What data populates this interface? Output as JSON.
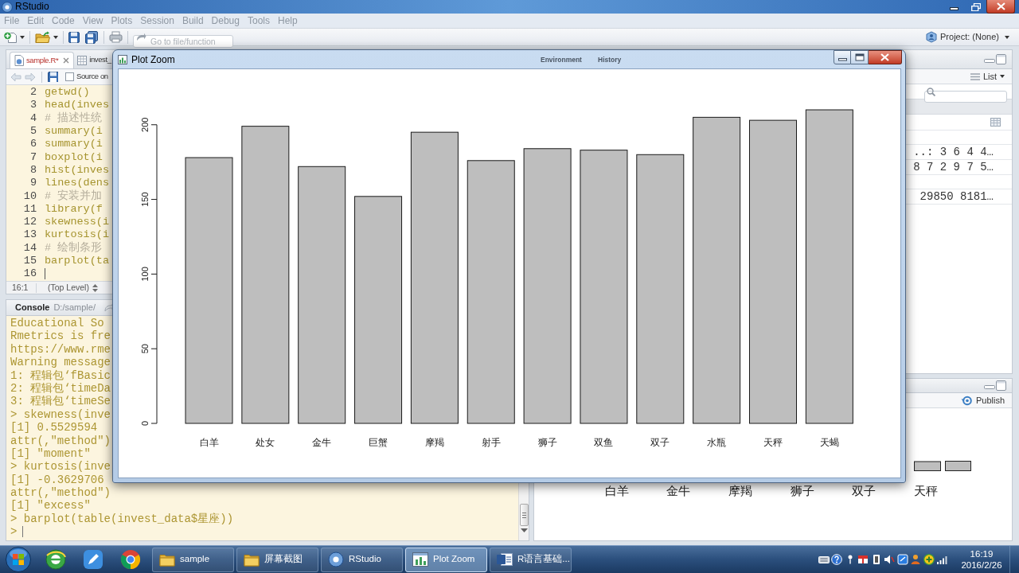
{
  "window": {
    "title": "RStudio"
  },
  "menu": [
    "File",
    "Edit",
    "Code",
    "View",
    "Plots",
    "Session",
    "Build",
    "Debug",
    "Tools",
    "Help"
  ],
  "toolbar": {
    "go_to_field": {
      "placeholder": "Go to file/function"
    },
    "project": "Project: (None)"
  },
  "editor": {
    "tabs": [
      {
        "label": "sample.R*",
        "selected": true,
        "modified": true,
        "kind": "script"
      },
      {
        "label": "invest_",
        "selected": false,
        "modified": false,
        "kind": "data"
      }
    ],
    "source_on_save": {
      "label": "Source on",
      "checked": false
    },
    "lines": [
      {
        "number": "2",
        "code": "getwd()",
        "kind": "code",
        "cursor": false
      },
      {
        "number": "3",
        "code": "head(inves",
        "kind": "code",
        "cursor": false
      },
      {
        "number": "4",
        "code": "# 描述性统",
        "kind": "comment",
        "cursor": false
      },
      {
        "number": "5",
        "code": "summary(i",
        "kind": "code",
        "cursor": false
      },
      {
        "number": "6",
        "code": "summary(i",
        "kind": "code",
        "cursor": false
      },
      {
        "number": "7",
        "code": "boxplot(i",
        "kind": "code",
        "cursor": false
      },
      {
        "number": "8",
        "code": "hist(inves",
        "kind": "code",
        "cursor": false
      },
      {
        "number": "9",
        "code": "lines(dens",
        "kind": "code",
        "cursor": false
      },
      {
        "number": "10",
        "code": "# 安装并加",
        "kind": "comment",
        "cursor": false
      },
      {
        "number": "11",
        "code": "library(f",
        "kind": "code",
        "cursor": false
      },
      {
        "number": "12",
        "code": "skewness(i",
        "kind": "code",
        "cursor": false
      },
      {
        "number": "13",
        "code": "kurtosis(i",
        "kind": "code",
        "cursor": false
      },
      {
        "number": "14",
        "code": "# 绘制条形",
        "kind": "comment",
        "cursor": false
      },
      {
        "number": "15",
        "code": "barplot(ta",
        "kind": "code",
        "cursor": false
      },
      {
        "number": "16",
        "kind": "code",
        "cursor": true
      }
    ],
    "status": {
      "position": "16:1",
      "scope": "(Top Level)"
    }
  },
  "console": {
    "title": "Console",
    "path": "D:/sample/",
    "lines": [
      "Educational So",
      "Rmetrics is fre",
      "https://www.rme",
      "Warning message",
      "1: 程辑包‘fBasic",
      "2: 程辑包‘timeDa",
      "3: 程辑包‘timeSe",
      "> skewness(inve",
      "[1] 0.5529594",
      "attr(,\"method\")",
      "[1] \"moment\"",
      "> kurtosis(inve",
      "[1] -0.3629706",
      "attr(,\"method\")",
      "[1] \"excess\"",
      "> barplot(table(invest_data$星座))"
    ],
    "prompt": ">",
    "cursor": true
  },
  "environment_pane": {
    "tabs": [
      {
        "label": "Environment"
      },
      {
        "label": "History"
      }
    ],
    "view_mode": "List",
    "rows": [
      {
        "kind": "section"
      },
      {
        "kind": "data-frame"
      },
      {
        "kind": "blank"
      },
      {
        "kind": "value",
        "text": "..: 3 6 4 4…"
      },
      {
        "kind": "value",
        "text": "8 7 2 9 7 5…"
      },
      {
        "kind": "blank"
      },
      {
        "kind": "value",
        "text": "29850 8181…"
      }
    ]
  },
  "plots_pane": {
    "publish": "Publish",
    "x_labels": [
      "白羊",
      "金牛",
      "摩羯",
      "狮子",
      "双子",
      "天秤"
    ]
  },
  "plot_zoom": {
    "title": "Plot Zoom",
    "chart_data": {
      "type": "bar",
      "categories": [
        "白羊",
        "处女",
        "金牛",
        "巨蟹",
        "摩羯",
        "射手",
        "狮子",
        "双鱼",
        "双子",
        "水瓶",
        "天秤",
        "天蝎"
      ],
      "values": [
        178,
        199,
        172,
        152,
        195,
        176,
        184,
        183,
        180,
        205,
        203,
        210
      ],
      "ylim": [
        0,
        210
      ],
      "yticks": [
        0,
        50,
        100,
        150,
        200
      ]
    }
  },
  "taskbar": {
    "tasks": [
      {
        "label": "sample",
        "kind": "folder",
        "selected": false
      },
      {
        "label": "屏幕截图",
        "kind": "folder",
        "selected": false
      },
      {
        "label": "RStudio",
        "kind": "rstudio",
        "selected": false
      },
      {
        "label": "Plot Zoom",
        "kind": "plot",
        "selected": true
      },
      {
        "label": "R语言基础...",
        "kind": "document",
        "selected": false
      }
    ],
    "clock": {
      "time": "16:19",
      "date": "2016/2/26"
    }
  }
}
